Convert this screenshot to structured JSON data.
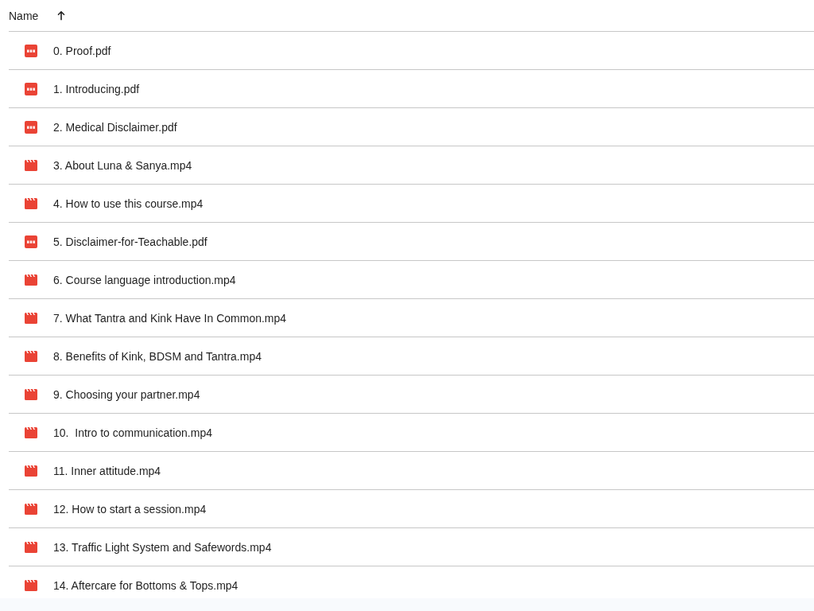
{
  "header": {
    "column_label": "Name",
    "sort_ascending": true
  },
  "files": [
    {
      "name": "0. Proof.pdf",
      "kind": "pdf"
    },
    {
      "name": "1. Introducing.pdf",
      "kind": "pdf"
    },
    {
      "name": "2. Medical Disclaimer.pdf",
      "kind": "pdf"
    },
    {
      "name": "3. About Luna & Sanya.mp4",
      "kind": "video"
    },
    {
      "name": "4. How to use this course.mp4",
      "kind": "video"
    },
    {
      "name": "5. Disclaimer-for-Teachable.pdf",
      "kind": "pdf"
    },
    {
      "name": "6. Course language introduction.mp4",
      "kind": "video"
    },
    {
      "name": "7. What Tantra and Kink Have In Common.mp4",
      "kind": "video"
    },
    {
      "name": "8. Benefits of Kink, BDSM and Tantra.mp4",
      "kind": "video"
    },
    {
      "name": "9. Choosing your partner.mp4",
      "kind": "video"
    },
    {
      "name": "10.  Intro to communication.mp4",
      "kind": "video"
    },
    {
      "name": "11. Inner attitude.mp4",
      "kind": "video"
    },
    {
      "name": "12. How to start a session.mp4",
      "kind": "video"
    },
    {
      "name": "13. Traffic Light System and Safewords.mp4",
      "kind": "video"
    },
    {
      "name": "14. Aftercare for Bottoms & Tops.mp4",
      "kind": "video"
    }
  ]
}
